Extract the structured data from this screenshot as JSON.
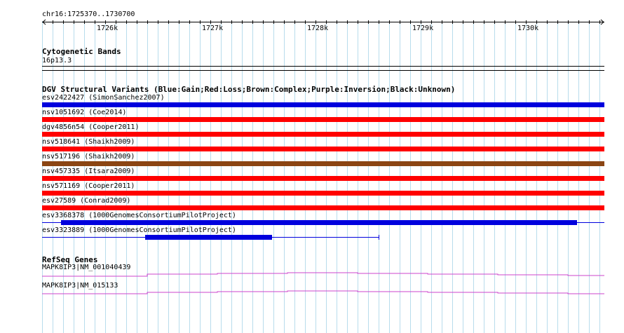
{
  "location": "chr16:1725370..1730700",
  "ruler_ticks": [
    "1726k",
    "1727k",
    "1728k",
    "1729k",
    "1730k"
  ],
  "cytoband": {
    "title": "Cytogenetic Bands",
    "band": "16p13.3"
  },
  "dgv": {
    "title": "DGV Structural Variants (Blue:Gain;Red:Loss;Brown:Complex;Purple:Inversion;Black:Unknown)",
    "colors": {
      "gain": "#0000dd",
      "loss": "#ff0000",
      "complex": "#8b4513"
    },
    "variants": [
      {
        "label": "esv2422427 (SimonSanchez2007)",
        "type": "gain"
      },
      {
        "label": "nsv1051692 (Coe2014)",
        "type": "loss"
      },
      {
        "label": "dgv4856n54 (Cooper2011)",
        "type": "loss"
      },
      {
        "label": "nsv518641 (Shaikh2009)",
        "type": "loss"
      },
      {
        "label": "nsv517196 (Shaikh2009)",
        "type": "complex"
      },
      {
        "label": "nsv457335 (Itsara2009)",
        "type": "loss"
      },
      {
        "label": "nsv571169 (Cooper2011)",
        "type": "loss"
      },
      {
        "label": "esv27589 (Conrad2009)",
        "type": "loss"
      },
      {
        "label": "esv3368378 (1000GenomesConsortiumPilotProject)",
        "type": "gain"
      },
      {
        "label": "esv3323889 (1000GenomesConsortiumPilotProject)",
        "type": "gain"
      }
    ]
  },
  "refseq": {
    "title": "RefSeq Genes",
    "color": "#cc44cc",
    "genes": [
      {
        "label": "MAPK8IP3|NM_001040439"
      },
      {
        "label": "MAPK8IP3|NM_015133"
      }
    ]
  }
}
